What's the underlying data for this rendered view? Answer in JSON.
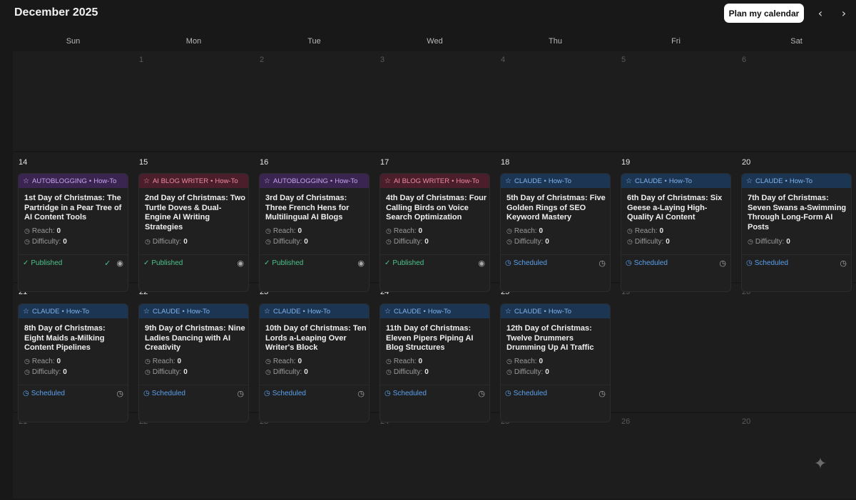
{
  "header": {
    "month_title": "December 2025",
    "plan_button": "Plan my calendar",
    "prev_icon": "chevron-left-icon",
    "next_icon": "chevron-right-icon"
  },
  "weekdays": [
    "Sun",
    "Mon",
    "Tue",
    "Wed",
    "Thu",
    "Fri",
    "Sat"
  ],
  "rows": [
    {
      "days": [
        "",
        "1",
        "2",
        "3",
        "4",
        "5",
        "6"
      ]
    },
    {
      "days": [
        "14",
        "15",
        "16",
        "17",
        "18",
        "19",
        "20"
      ]
    },
    {
      "days": [
        "21",
        "22",
        "23",
        "24",
        "25",
        "19",
        "20"
      ]
    },
    {
      "days": [
        "21",
        "22",
        "23",
        "24",
        "25",
        "26",
        "20"
      ]
    }
  ],
  "labels": {
    "reach": "Reach:",
    "difficulty": "Difficulty:",
    "separator": "•"
  },
  "posts": [
    {
      "source": "AUTOBLOGGING",
      "type": "How-To",
      "color": "#3a2550",
      "title": "1st Day of Christmas: The Partridge in a Pear Tree of AI Content Tools",
      "reach": "0",
      "difficulty": "0",
      "status": "Published"
    },
    {
      "source": "AI BLOG WRITER",
      "type": "How-To",
      "color": "#4a1f2b",
      "title": "2nd Day of Christmas: Two Turtle Doves & Dual-Engine AI Writing Strategies",
      "reach": "",
      "difficulty": "0",
      "status": "Published"
    },
    {
      "source": "AUTOBLOGGING",
      "type": "How-To",
      "color": "#3a2550",
      "title": "3rd Day of Christmas: Three French Hens for Multilingual AI Blogs",
      "reach": "0",
      "difficulty": "0",
      "status": "Published"
    },
    {
      "source": "AI BLOG WRITER",
      "type": "How-To",
      "color": "#4a1f2b",
      "title": "4th Day of Christmas: Four Calling Birds on Voice Search Optimization",
      "reach": "0",
      "difficulty": "0",
      "status": "Published"
    },
    {
      "source": "CLAUDE",
      "type": "How-To",
      "color": "#1c3552",
      "title": "5th Day of Christmas: Five Golden Rings of SEO Keyword Mastery",
      "reach": "0",
      "difficulty": "0",
      "status": "Scheduled"
    },
    {
      "source": "CLAUDE",
      "type": "How-To",
      "color": "#1c3552",
      "title": "6th Day of Christmas: Six Geese a-Laying High-Quality AI Content",
      "reach": "0",
      "difficulty": "0",
      "status": "Scheduled"
    },
    {
      "source": "CLAUDE",
      "type": "How-To",
      "color": "#1c3552",
      "title": "7th Day of Christmas: Seven Swans a-Swimming Through Long-Form AI Posts",
      "reach": "",
      "difficulty": "0",
      "status": "Scheduled"
    },
    {
      "source": "CLAUDE",
      "type": "How-To",
      "color": "#1c3552",
      "title": "8th Day of Christmas: Eight Maids a-Milking Content Pipelines",
      "reach": "0",
      "difficulty": "0",
      "status": "Scheduled"
    },
    {
      "source": "CLAUDE",
      "type": "How-To",
      "color": "#1c3552",
      "title": "9th Day of Christmas: Nine Ladies Dancing with AI Creativity",
      "reach": "0",
      "difficulty": "0",
      "status": "Scheduled"
    },
    {
      "source": "CLAUDE",
      "type": "How-To",
      "color": "#1c3552",
      "title": "10th Day of Christmas: Ten Lords a-Leaping Over Writer's Block",
      "reach": "0",
      "difficulty": "0",
      "status": "Scheduled"
    },
    {
      "source": "CLAUDE",
      "type": "How-To",
      "color": "#1c3552",
      "title": "11th Day of Christmas: Eleven Pipers Piping AI Blog Structures",
      "reach": "0",
      "difficulty": "0",
      "status": "Scheduled"
    },
    {
      "source": "CLAUDE",
      "type": "How-To",
      "color": "#1c3552",
      "title": "12th Day of Christmas: Twelve Drummers Drumming Up AI Traffic",
      "reach": "0",
      "difficulty": "0",
      "status": "Scheduled"
    }
  ]
}
